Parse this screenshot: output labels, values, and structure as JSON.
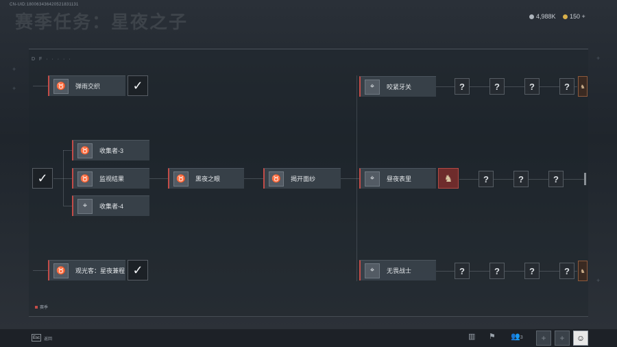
{
  "header": {
    "uid": "CN-UID:180063436420521831131",
    "title": "赛季任务：星夜之子",
    "currency1": "4,988K",
    "currency2": "150",
    "currency2_plus": "+"
  },
  "panel": {
    "header_text": "D F ·  ·  ·  ·  ·"
  },
  "nodes": {
    "a1": "弹雨交织",
    "a2": "观光客：星夜兼程",
    "b1": "收集者-3",
    "b2": "监视结果",
    "b3": "收集者-4",
    "c1": "黑夜之眼",
    "d1": "揭开面纱",
    "e1": "咬紧牙关",
    "e2": "昼夜表里",
    "e3": "无畏战士"
  },
  "icons": {
    "node_icon": "♉",
    "alt_icon": "⌖",
    "check": "✓",
    "unknown": "?",
    "reward": "♞"
  },
  "legend": {
    "label": "赛季"
  },
  "bottom": {
    "esc_key": "Esc",
    "esc_label": "返回",
    "player_count": "3"
  },
  "colors": {
    "accent": "#c44c48"
  }
}
